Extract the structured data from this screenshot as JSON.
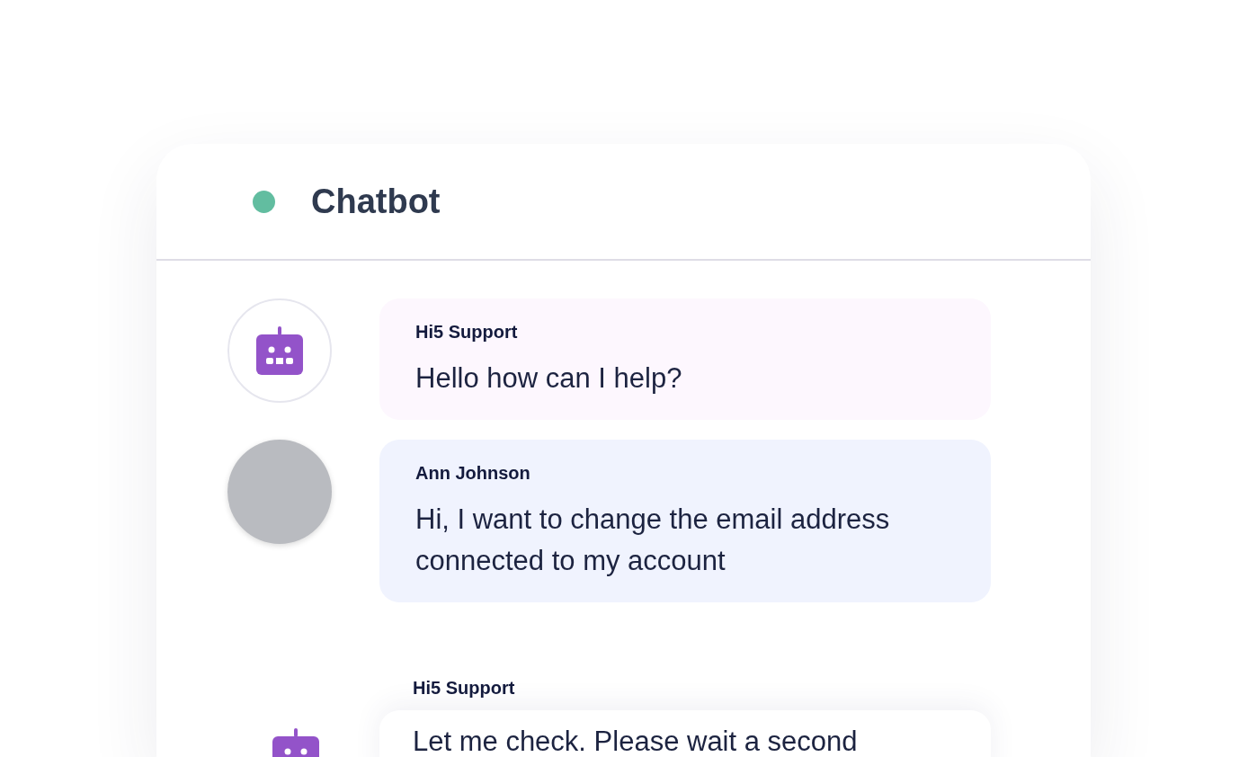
{
  "header": {
    "title": "Chatbot",
    "status": {
      "color": "#62bda0"
    }
  },
  "messages": [
    {
      "sender": "Hi5 Support",
      "text": "Hello how can I help?",
      "avatar": {
        "kind": "bot"
      },
      "kind": "inline",
      "color": "#fdf7fe"
    },
    {
      "sender": "Ann Johnson",
      "text": "Hi, I want to change the email address connected to my account",
      "avatar": {
        "kind": "photo"
      },
      "kind": "inline",
      "color": "#f0f3fe"
    },
    {
      "sender": "Hi5 Support",
      "text": "Let me check. Please wait a second",
      "avatar": {
        "kind": "bot-plain"
      },
      "kind": "stacked",
      "color": "#ffffff"
    }
  ]
}
